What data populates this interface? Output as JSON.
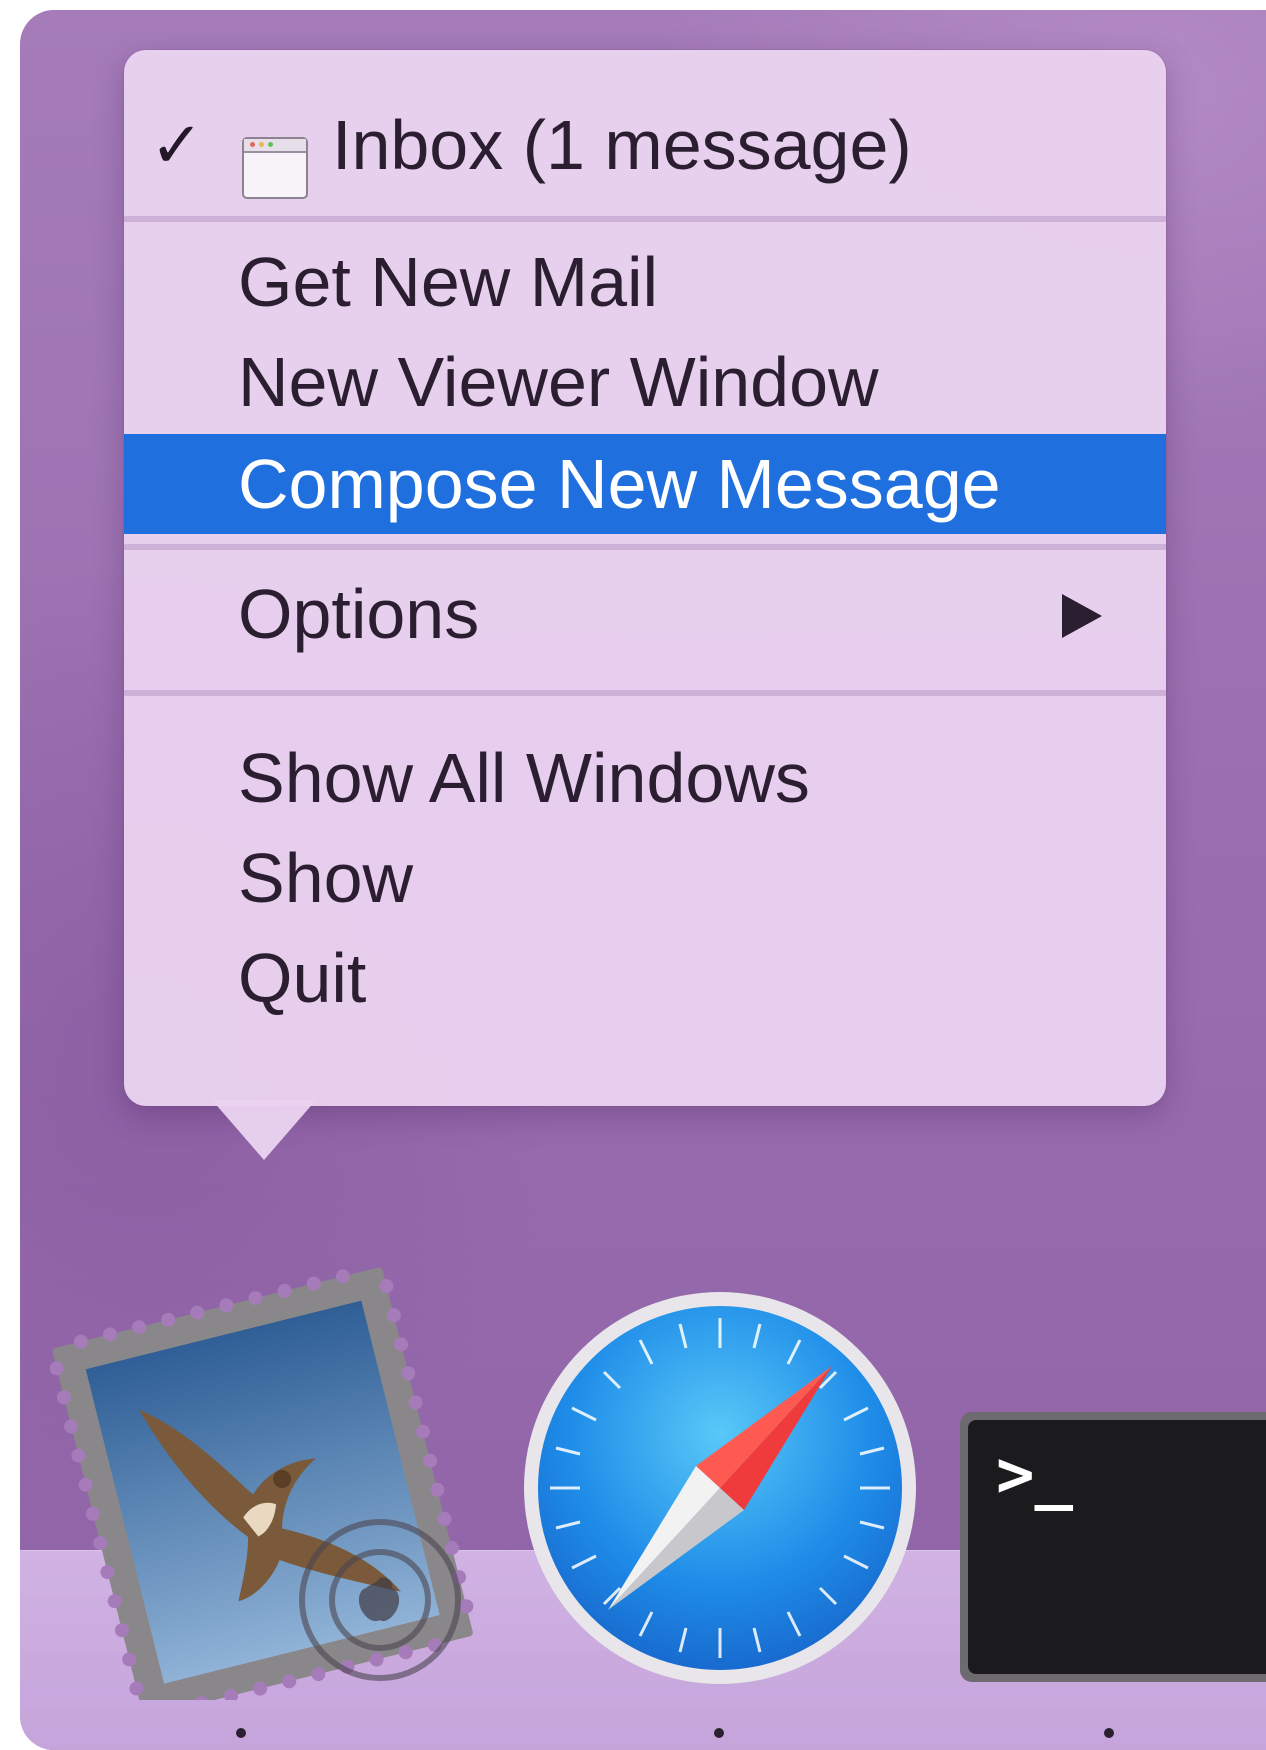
{
  "context_menu": {
    "window_item": {
      "label": "Inbox (1 message)",
      "checked": true,
      "check_glyph": "✓",
      "icon": "window-icon"
    },
    "actions": [
      {
        "label": "Get New Mail"
      },
      {
        "label": "New Viewer Window"
      },
      {
        "label": "Compose New Message",
        "highlighted": true
      }
    ],
    "options": {
      "label": "Options",
      "has_submenu": true
    },
    "app_actions": [
      {
        "label": "Show All Windows"
      },
      {
        "label": "Show"
      },
      {
        "label": "Quit"
      }
    ]
  },
  "dock": {
    "apps": [
      {
        "name": "mail-app-icon",
        "running": true
      },
      {
        "name": "safari-app-icon",
        "running": true
      },
      {
        "name": "terminal-app-icon",
        "running": true
      }
    ],
    "terminal_prompt": ">_"
  },
  "colors": {
    "highlight": "#1f6fde",
    "menu_background": "#e9d2f0",
    "desktop": "#9a6fb0",
    "dock_shelf": "#d6b8e8"
  }
}
